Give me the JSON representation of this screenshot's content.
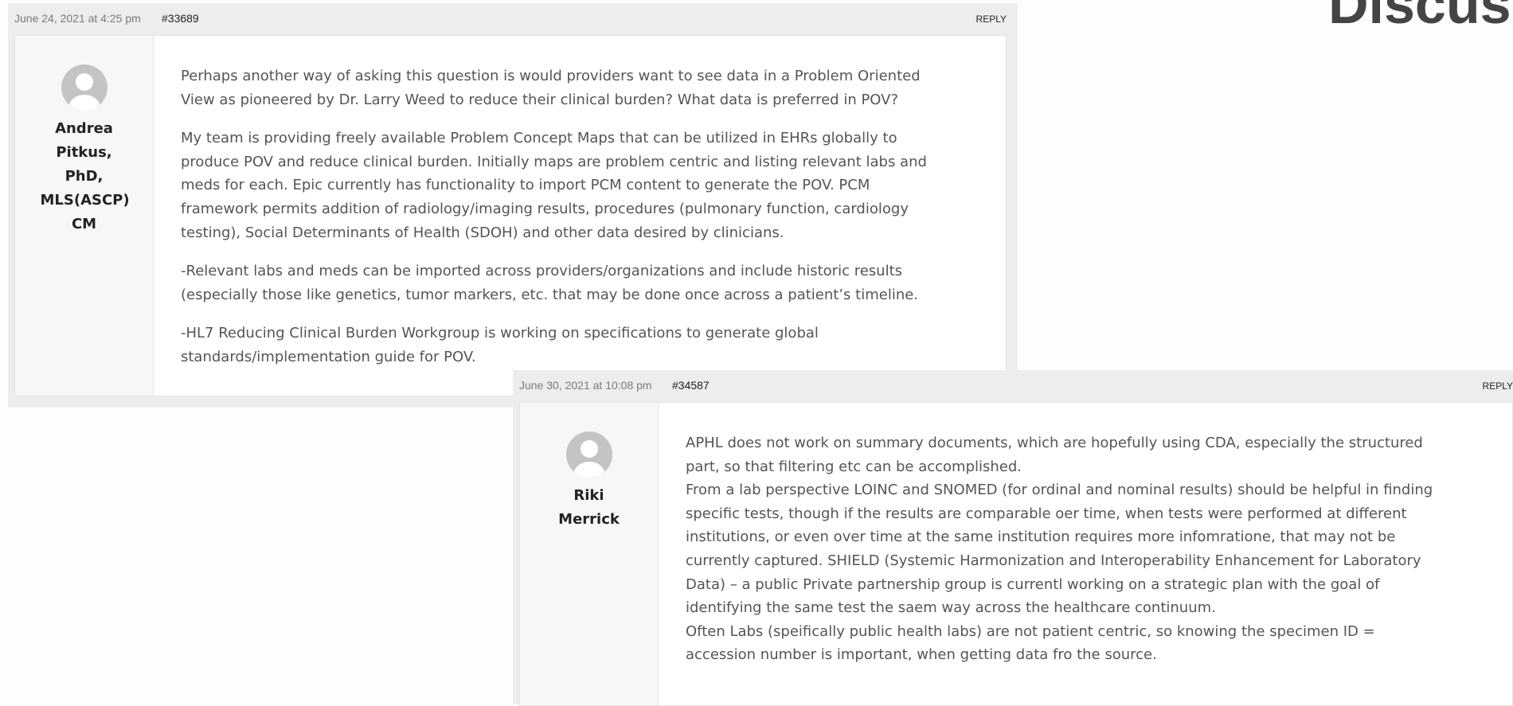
{
  "page": {
    "heading": "Discus"
  },
  "replies": [
    {
      "date": "June 24, 2021 at 4:25 pm",
      "permalink": "#33689",
      "reply_label": "REPLY",
      "author": "Andrea Pitkus, PhD, MLS(ASCP) CM",
      "paragraphs": [
        "Perhaps another way of asking this question is would providers want to see data in a Problem Oriented View as pioneered by Dr. Larry Weed to reduce their clinical burden? What data is preferred in POV?",
        "My team is providing freely available Problem Concept Maps that can be utilized in EHRs globally to produce POV and reduce clinical burden. Initially maps are problem centric and listing relevant labs and meds for each. Epic currently has functionality to import PCM content to generate the POV. PCM framework permits addition of radiology/imaging results, procedures (pulmonary function, cardiology testing), Social Determinants of Health (SDOH) and other data desired by clinicians.",
        "-Relevant labs and meds can be imported across providers/organizations and include historic results (especially those like genetics, tumor markers, etc. that may be done once across a patient’s timeline.",
        "-HL7 Reducing Clinical Burden Workgroup is working on specifications to generate global standards/implementation guide for POV."
      ]
    },
    {
      "date": "June 30, 2021 at 10:08 pm",
      "permalink": "#34587",
      "reply_label": "REPLY",
      "author": "Riki Merrick",
      "paragraphs": [
        "APHL does not work on summary documents, which are hopefully using CDA, especially the structured part, so that filtering etc can be accomplished.",
        "From a lab perspective LOINC and SNOMED (for ordinal and nominal results) should be helpful in finding specific tests, though if the results are comparable oer time, when tests were performed at different institutions, or even over time at the same institution requires more infomratione, that may not be currently captured. SHIELD (Systemic Harmonization and Interoperability Enhancement for Laboratory Data) – a public Private partnership group is currentl working on a strategic plan with the goal of identifying the same test the saem way across the healthcare continuum.",
        "Often Labs (speifically public health labs) are not patient centric, so knowing the specimen ID = accession number is important, when getting data fro the source."
      ]
    }
  ]
}
